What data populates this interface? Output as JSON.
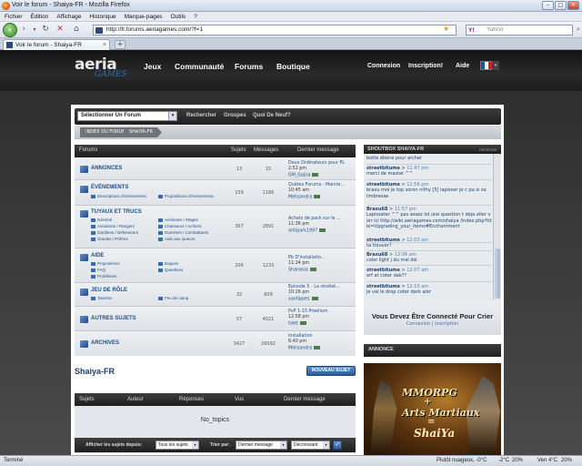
{
  "browser": {
    "title": "Voir le forum - Shaiya-FR - Mozilla Firefox",
    "menu": [
      "Fichier",
      "Édition",
      "Affichage",
      "Historique",
      "Marque-pages",
      "Outils",
      "?"
    ],
    "url": "http://fr.forums.aeriagames.com/?f=1",
    "search_placeholder": "Yahoo",
    "search_engine_icon": "Y!",
    "tab_title": "Voir le forum - Shaiya-FR",
    "status_left": "Terminé",
    "status_weather": "Plutôt nuageux, -0°C",
    "status_temp1": "-2°C",
    "status_pct1": "20%",
    "status_ven": "Ven 4°C",
    "status_pct2": "20%"
  },
  "site": {
    "logo_main": "aeria",
    "logo_sub": "GAMES",
    "nav": [
      "Jeux",
      "Communauté",
      "Forums",
      "Boutique"
    ],
    "connexion": "Connexion",
    "inscription": "Inscription!",
    "aide": "Aide"
  },
  "toolbar": {
    "select_label": "Sélectionner Un Forum",
    "links": [
      "Rechercher",
      "Groupes",
      "Quoi De Neuf?"
    ]
  },
  "breadcrumb": [
    "INDEX DU FORUM",
    "SHAIYA-FR"
  ],
  "forum_table": {
    "headers": {
      "forums": "Forums",
      "sujets": "Sujets",
      "messages": "Messages",
      "dernier": "Dernier message"
    },
    "rows": [
      {
        "name": "ANNONCES",
        "subs": [],
        "sujets": "13",
        "messages": "15",
        "lp_title": "Deux Ordinateurs pour PL",
        "lp_time": "2:52 pm",
        "lp_user": "GM_Gojira"
      },
      {
        "name": "ÉVÉNEMENTS",
        "subs": [
          "Descriptions d'événements",
          "Propositions d'événements"
        ],
        "sujets": "159",
        "messages": "1186",
        "lp_title": "Quêtes Forums : Mainte...",
        "lp_time": "10:45 am",
        "lp_user": "Melisandra"
      },
      {
        "name": "TUYAUX ET TRUCS",
        "subs": [
          "Général",
          "Animistes / Mages",
          "Assassins / Rangers",
          "Chasseurs / Archers",
          "Gardiens / Défenseurs",
          "Guerriers / Combattants",
          "Oracles / Prêtres",
          "Aide aux joueurs"
        ],
        "sujets": "367",
        "messages": "2891",
        "lp_title": "Achats de pack sur le ...",
        "lp_time": "11:36 pm",
        "lp_user": "antipark1997"
      },
      {
        "name": "AIDE",
        "subs": [
          "Propositions",
          "Bogues",
          "FAQ",
          "Questions",
          "Problèmes"
        ],
        "sujets": "206",
        "messages": "1233",
        "lp_title": "Pb D'installatio...",
        "lp_time": "11:24 pm",
        "lp_user": "Shanasia"
      },
      {
        "name": "JEU DE RÔLE",
        "subs": [
          "Taverne",
          "Feu de camp"
        ],
        "sujets": "32",
        "messages": "609",
        "lp_title": "Episode 5 - La révélat...",
        "lp_time": "10:26 pm",
        "lp_user": "xantippes"
      },
      {
        "name": "AUTRES SUJETS",
        "subs": [],
        "sujets": "57",
        "messages": "4021",
        "lp_title": "PvP 1-15 Proelium",
        "lp_time": "12:58 pm",
        "lp_user": "talet"
      },
      {
        "name": "ARCHIVES",
        "subs": [],
        "sujets": "3427",
        "messages": "26092",
        "lp_title": "Installation",
        "lp_time": "6:40 pm",
        "lp_user": "Melisandra"
      }
    ]
  },
  "shoutbox": {
    "title": "SHOUTBOX SHAIYA-FR",
    "minimize": "minimiser",
    "rows": [
      {
        "user": "",
        "time": "",
        "msg": "botte ébène pour archer"
      },
      {
        "user": "streetbitume",
        "time": "11:47 pm",
        "msg": "merci de master ^^"
      },
      {
        "user": "streetbitume",
        "time": "11:56 pm",
        "msg": "braxu moi je top soron nithy [5] lapisser je c pa si sa limbresse"
      },
      {
        "user": "Braxu68",
        "time": "11:57 pm",
        "msg": "Lapissater ^^ pas assez lol une question t deja aller voir ici http://wiki.aeriagames.com/shaiya /index.php?title=Upgrading_your_items#Enchantment"
      },
      {
        "user": "streetbitume",
        "time": "12:03 am",
        "msg": "ta trouver?"
      },
      {
        "user": "Braxu68",
        "time": "12:06 am",
        "msg": "color light j du mal dsl"
      },
      {
        "user": "streetbitume",
        "time": "12:07 am",
        "msg": "erf at coter dak??"
      },
      {
        "user": "streetbitume",
        "time": "12:10 am",
        "msg": "je vai le drop coter dark alor"
      }
    ],
    "login_title": "Vous Devez Être Connecté Pour Crier",
    "login_link": "Connexion",
    "register_link": "Inscription"
  },
  "annonce": {
    "title": "ANNONCE",
    "line1": "MMORPG",
    "plus": "+",
    "line2": "Arts Martiaux",
    "eq": "=",
    "line3": "ShaiYa"
  },
  "forum_title": "Shaiya-FR",
  "new_topic_button": "NOUVEAU SUJET",
  "topics_table": {
    "headers": [
      "Sujets",
      "Auteur",
      "Réponses",
      "Vus",
      "Dernier message"
    ],
    "empty": "No_topics",
    "filter_label": "Afficher les sujets depuis:",
    "filter_value": "Tous les sujets",
    "sort_label": "Trier par:",
    "sort_value": "Dernier message",
    "order_value": "Décroissant"
  }
}
